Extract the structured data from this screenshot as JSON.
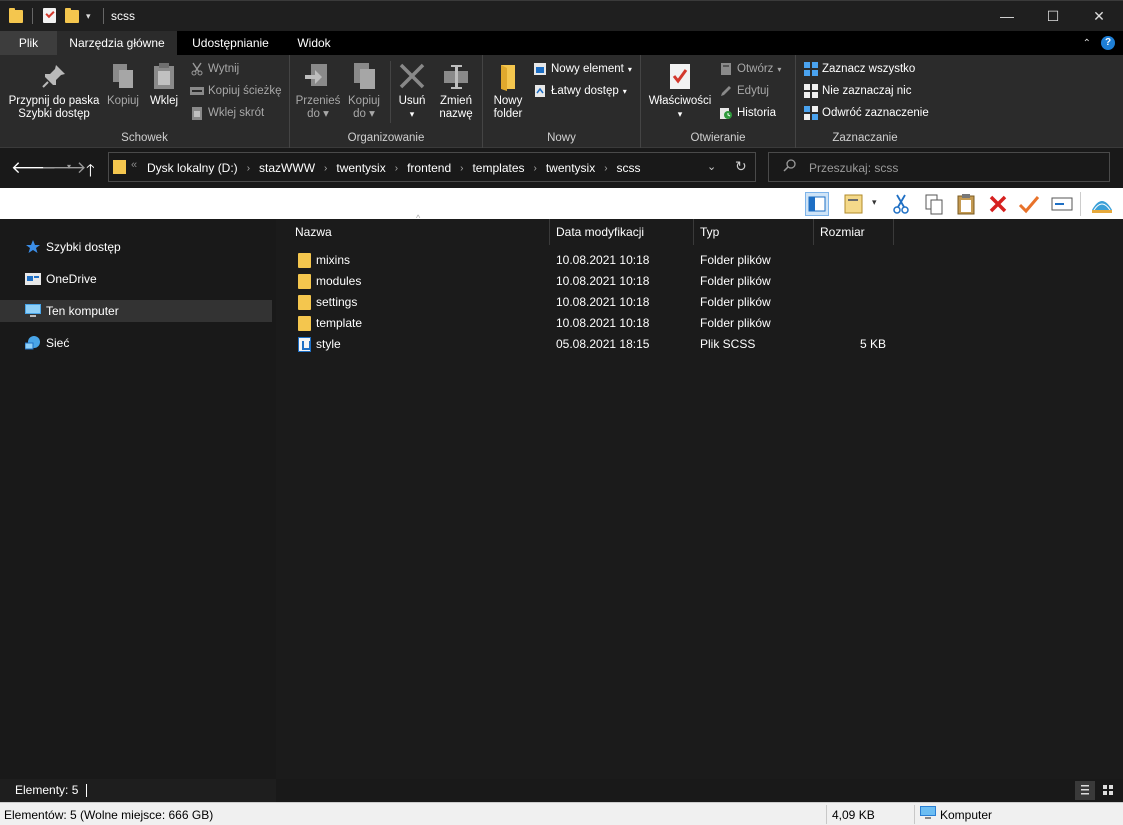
{
  "window": {
    "title": "scss",
    "minimize_glyph": "—",
    "maximize_glyph": "☐",
    "close_glyph": "✕"
  },
  "tabs": [
    {
      "label": "Plik"
    },
    {
      "label": "Narzędzia główne"
    },
    {
      "label": "Udostępnianie"
    },
    {
      "label": "Widok"
    }
  ],
  "ribbon": {
    "schowek": {
      "label": "Schowek",
      "pin_line1": "Przypnij do paska",
      "pin_line2": "Szybki dostęp",
      "copy": "Kopiuj",
      "paste": "Wklej",
      "cut": "Wytnij",
      "copy_path": "Kopiuj ścieżkę",
      "paste_shortcut": "Wklej skrót"
    },
    "organizowanie": {
      "label": "Organizowanie",
      "move_line1": "Przenieś",
      "move_line2": "do",
      "copy_line1": "Kopiuj",
      "copy_line2": "do",
      "delete": "Usuń",
      "rename_line1": "Zmień",
      "rename_line2": "nazwę"
    },
    "nowy": {
      "label": "Nowy",
      "folder_line1": "Nowy",
      "folder_line2": "folder",
      "new_item": "Nowy element",
      "easy_access": "Łatwy dostęp"
    },
    "otwieranie": {
      "label": "Otwieranie",
      "properties": "Właściwości",
      "open": "Otwórz",
      "edit": "Edytuj",
      "history": "Historia"
    },
    "zaznaczanie": {
      "label": "Zaznaczanie",
      "select_all": "Zaznacz wszystko",
      "select_none": "Nie zaznaczaj nic",
      "invert": "Odwróć zaznaczenie"
    }
  },
  "address": {
    "back": "🡐",
    "forward": "🡒",
    "up": "🡑",
    "overflow": "«",
    "crumbs": [
      "Dysk lokalny (D:)",
      "stazWWW",
      "twentysix",
      "frontend",
      "templates",
      "twentysix",
      "scss"
    ],
    "crumb_sep": "›",
    "dropdown_glyph": "⌄",
    "refresh_glyph": "↻"
  },
  "search": {
    "placeholder": "Przeszukaj: scss",
    "icon": "search-icon"
  },
  "nav": [
    {
      "label": "Szybki dostęp",
      "icon": "star-icon"
    },
    {
      "label": "OneDrive",
      "icon": "onedrive-icon"
    },
    {
      "label": "Ten komputer",
      "icon": "computer-icon"
    },
    {
      "label": "Sieć",
      "icon": "network-icon"
    }
  ],
  "columns": {
    "name": "Nazwa",
    "date": "Data modyfikacji",
    "type": "Typ",
    "size": "Rozmiar"
  },
  "files": [
    {
      "name": "mixins",
      "date": "10.08.2021 10:18",
      "type": "Folder plików",
      "size": "",
      "icon": "folder-icon"
    },
    {
      "name": "modules",
      "date": "10.08.2021 10:18",
      "type": "Folder plików",
      "size": "",
      "icon": "folder-icon"
    },
    {
      "name": "settings",
      "date": "10.08.2021 10:18",
      "type": "Folder plików",
      "size": "",
      "icon": "folder-icon"
    },
    {
      "name": "template",
      "date": "10.08.2021 10:18",
      "type": "Folder plików",
      "size": "",
      "icon": "folder-icon"
    },
    {
      "name": "style",
      "date": "05.08.2021 18:15",
      "type": "Plik SCSS",
      "size": "5 KB",
      "icon": "scss-file-icon"
    }
  ],
  "status": {
    "items": "Elementy: 5",
    "bottom_left": "Elementów: 5 (Wolne miejsce: 666 GB)",
    "size": "4,09 KB",
    "location": "Komputer"
  },
  "colors": {
    "accent": "#1e7fd6",
    "folder": "#f4c64e",
    "background": "#1b1b1b"
  }
}
